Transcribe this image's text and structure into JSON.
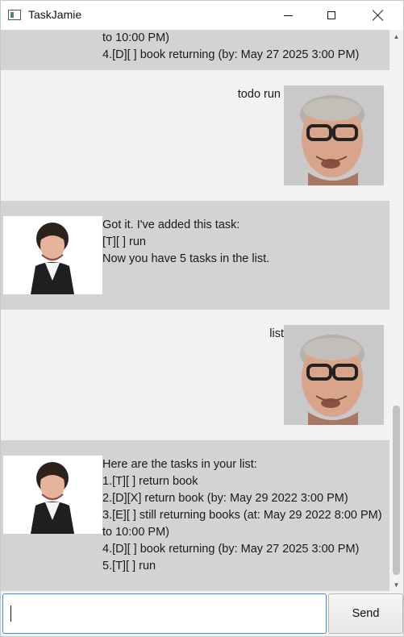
{
  "window": {
    "title": "TaskJamie",
    "controls": {
      "minimize": "minimize-icon",
      "maximize": "maximize-icon",
      "close": "close-icon"
    }
  },
  "chat": {
    "messages": [
      {
        "sender": "bot",
        "lines": [
          "to 10:00 PM)",
          "4.[D][ ] book returning (by: May 27 2025 3:00 PM)"
        ]
      },
      {
        "sender": "user",
        "lines": [
          "todo run"
        ]
      },
      {
        "sender": "bot",
        "lines": [
          "Got it. I've added this task:",
          "[T][ ] run",
          "Now you have 5 tasks in the list."
        ]
      },
      {
        "sender": "user",
        "lines": [
          "list"
        ]
      },
      {
        "sender": "bot",
        "lines": [
          "Here are the tasks in your list:",
          "1.[T][ ] return book",
          "2.[D][X] return book (by: May 29 2022 3:00 PM)",
          "3.[E][ ] still returning books (at: May 29 2022 8:00 PM)",
          "to 10:00 PM)",
          "4.[D][ ] book returning (by: May 27 2025 3:00 PM)",
          "5.[T][ ] run"
        ]
      }
    ]
  },
  "input": {
    "value": "",
    "placeholder": ""
  },
  "send_button": {
    "label": "Send"
  },
  "scrollbar": {
    "up": "scroll-up-arrow",
    "down": "scroll-down-arrow"
  }
}
